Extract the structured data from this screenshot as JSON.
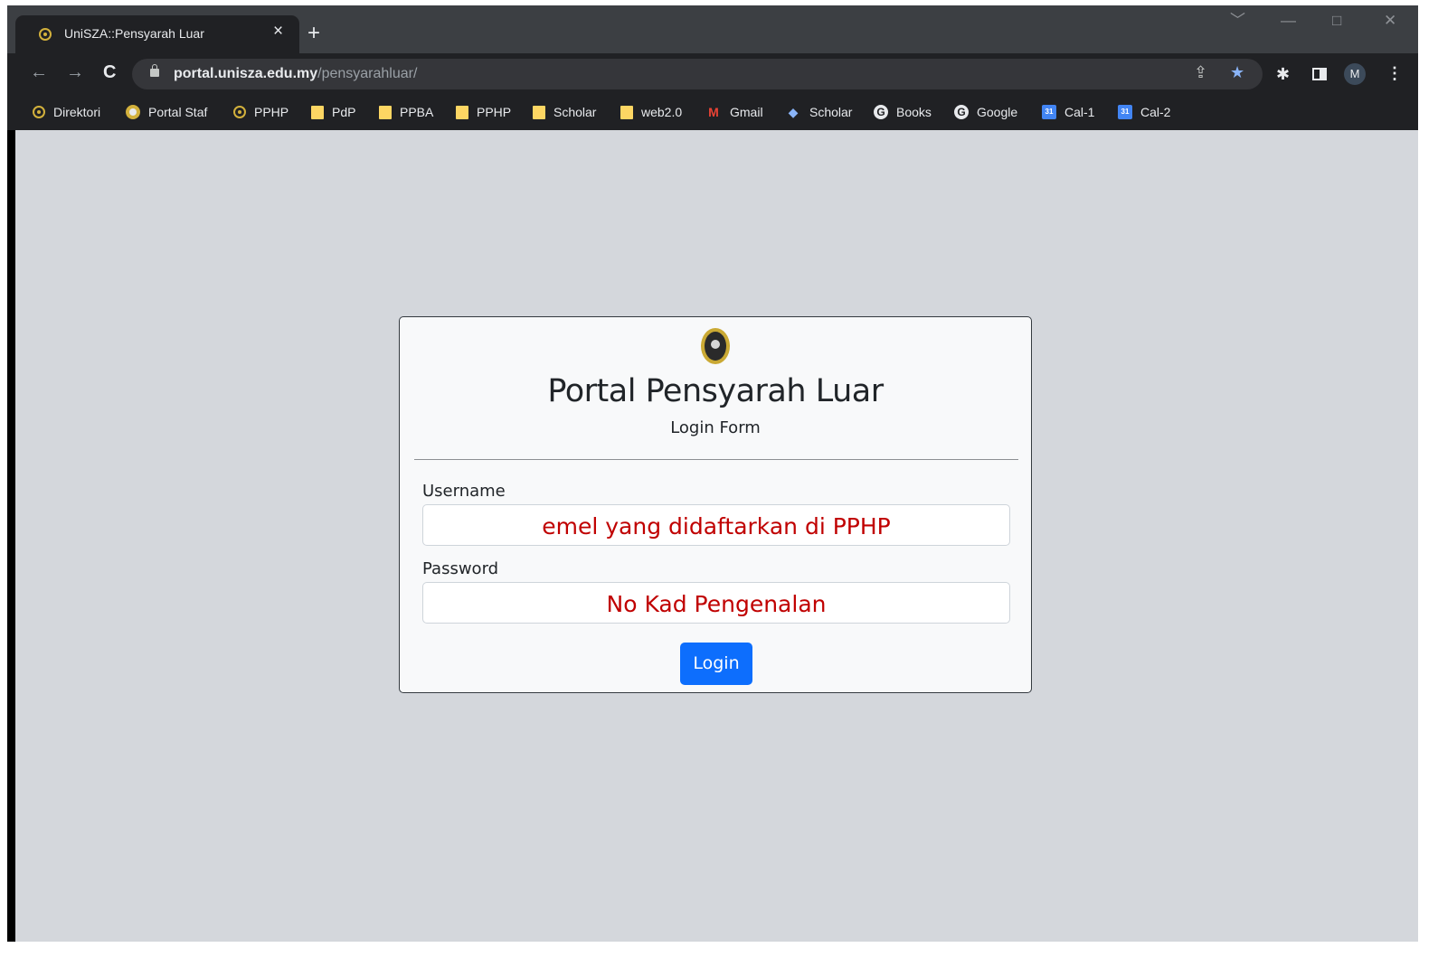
{
  "browser": {
    "tab": {
      "title": "UniSZA::Pensyarah Luar",
      "close": "×"
    },
    "new_tab": "+",
    "window_controls": {
      "dropdown": "﹀",
      "minimize": "—",
      "maximize": "□",
      "close": "✕"
    },
    "nav": {
      "back": "←",
      "forward": "→",
      "reload": "C"
    },
    "address": {
      "host": "portal.unisza.edu.my",
      "path": "/pensyarahluar/"
    },
    "profile_initial": "M",
    "menu": "⋮"
  },
  "bookmarks": [
    {
      "label": "Direktori",
      "icon": "unisza-crest-icon"
    },
    {
      "label": "Portal Staf",
      "icon": "unisza-crest-icon"
    },
    {
      "label": "PPHP",
      "icon": "unisza-crest-icon"
    },
    {
      "label": "PdP",
      "icon": "folder-icon"
    },
    {
      "label": "PPBA",
      "icon": "folder-icon"
    },
    {
      "label": "PPHP",
      "icon": "folder-icon"
    },
    {
      "label": "Scholar",
      "icon": "folder-icon"
    },
    {
      "label": "web2.0",
      "icon": "folder-icon"
    },
    {
      "label": "Gmail",
      "icon": "gmail-icon"
    },
    {
      "label": "Scholar",
      "icon": "scholar-icon"
    },
    {
      "label": "Books",
      "icon": "google-icon"
    },
    {
      "label": "Google",
      "icon": "google-icon"
    },
    {
      "label": "Cal-1",
      "icon": "calendar-icon"
    },
    {
      "label": "Cal-2",
      "icon": "calendar-icon"
    }
  ],
  "login": {
    "title": "Portal Pensyarah Luar",
    "subtitle": "Login Form",
    "username_label": "Username",
    "username_hint": "emel yang didaftarkan di PPHP",
    "password_label": "Password",
    "password_hint": "No Kad Pengenalan",
    "button_label": "Login"
  },
  "colors": {
    "page_background": "#d4d7dc",
    "hint_text": "#c00000",
    "button": "#0d6efd"
  }
}
